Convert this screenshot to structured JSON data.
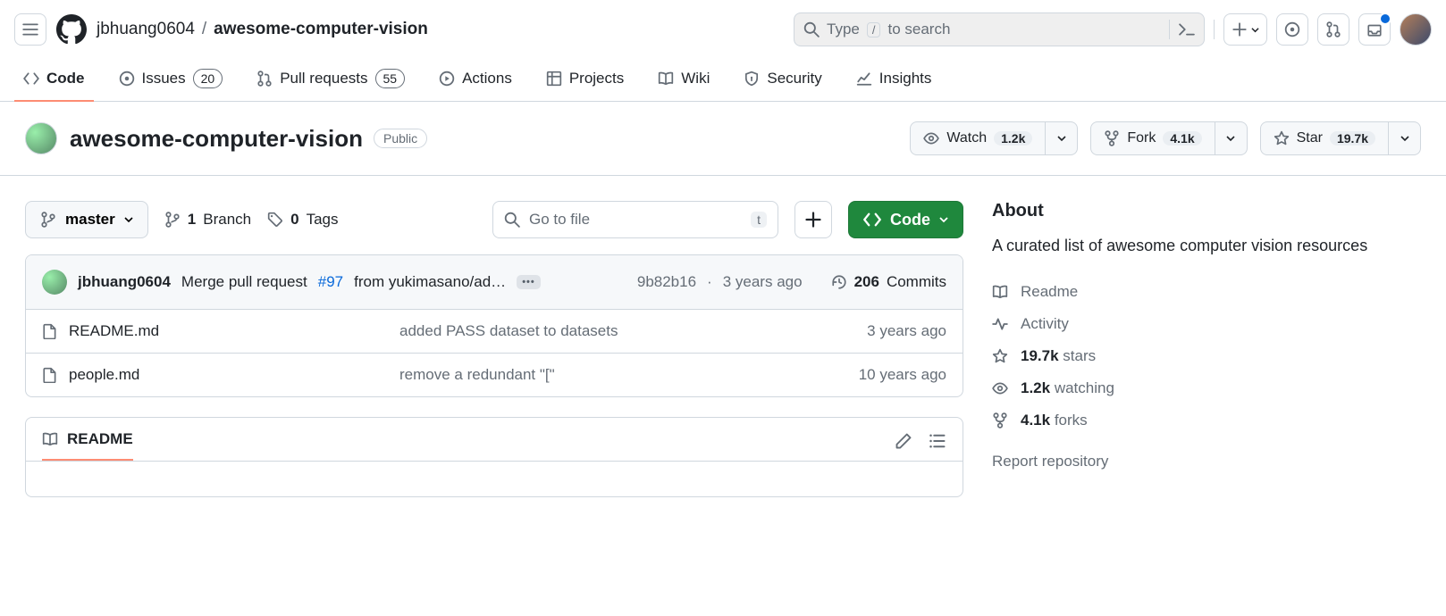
{
  "header": {
    "owner": "jbhuang0604",
    "repo": "awesome-computer-vision",
    "search_placeholder_prefix": "Type",
    "search_placeholder_suffix": "to search",
    "search_kbd": "/"
  },
  "tabs": {
    "code": "Code",
    "issues": "Issues",
    "issues_count": "20",
    "pulls": "Pull requests",
    "pulls_count": "55",
    "actions": "Actions",
    "projects": "Projects",
    "wiki": "Wiki",
    "security": "Security",
    "insights": "Insights"
  },
  "repo": {
    "name": "awesome-computer-vision",
    "visibility": "Public",
    "watch_label": "Watch",
    "watch_count": "1.2k",
    "fork_label": "Fork",
    "fork_count": "4.1k",
    "star_label": "Star",
    "star_count": "19.7k"
  },
  "controls": {
    "branch": "master",
    "branch_count": "1",
    "branch_label": "Branch",
    "tags_count": "0",
    "tags_label": "Tags",
    "go_to_file": "Go to file",
    "file_kbd": "t",
    "code_button": "Code"
  },
  "latest_commit": {
    "author": "jbhuang0604",
    "message_prefix": "Merge pull request",
    "pr": "#97",
    "message_suffix": "from yukimasano/ad…",
    "sha": "9b82b16",
    "age": "3 years ago",
    "commits_count": "206",
    "commits_label": "Commits"
  },
  "files": [
    {
      "name": "README.md",
      "msg": "added PASS dataset to datasets",
      "age": "3 years ago"
    },
    {
      "name": "people.md",
      "msg": "remove a redundant \"[\"",
      "age": "10 years ago"
    }
  ],
  "readme": {
    "tab": "README"
  },
  "about": {
    "title": "About",
    "description": "A curated list of awesome computer vision resources",
    "readme": "Readme",
    "activity": "Activity",
    "stars_bold": "19.7k",
    "stars_label": "stars",
    "watching_bold": "1.2k",
    "watching_label": "watching",
    "forks_bold": "4.1k",
    "forks_label": "forks",
    "report": "Report repository"
  }
}
